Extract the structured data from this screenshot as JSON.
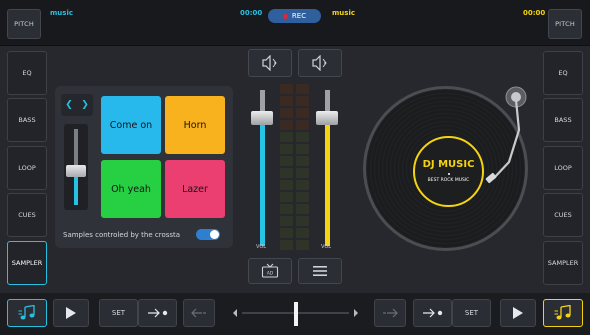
{
  "top": {
    "pitch_left": "PITCH",
    "pitch_right": "PITCH",
    "deck_a_track": "music",
    "deck_a_time": "00:00",
    "rec_label": "REC",
    "deck_b_track": "music",
    "deck_b_time": "00:00"
  },
  "left_side": [
    "EQ",
    "BASS",
    "LOOP",
    "CUES",
    "SAMPLER"
  ],
  "right_side": [
    "EQ",
    "BASS",
    "LOOP",
    "CUES",
    "SAMPLER"
  ],
  "sampler": {
    "pads": [
      {
        "label": "Come on",
        "color": "#27b8ec"
      },
      {
        "label": "Horn",
        "color": "#f8b21d"
      },
      {
        "label": "Oh yeah",
        "color": "#27cf43"
      },
      {
        "label": "Lazer",
        "color": "#ec3f71"
      }
    ],
    "note": "Samples controled by the crossta",
    "volume_fraction": 0.45,
    "toggle_on": true
  },
  "mixer": {
    "vol_left_label": "VOL",
    "vol_right_label": "VOL",
    "vol_left_fraction": 0.82,
    "vol_right_fraction": 0.82,
    "left_color": "#27c3e6",
    "right_color": "#f5d313"
  },
  "deck": {
    "title": "DJ MUSIC",
    "subtitle": "BEST ROCK MUSIC",
    "label_color": "#f5d313"
  },
  "bottom": {
    "set_left": "SET",
    "set_right": "SET",
    "crossfader_fraction": 0.5
  },
  "colors": {
    "accent_blue": "#27c0e0",
    "accent_yellow": "#f5d313",
    "rec_bg": "#2f5f9d"
  }
}
